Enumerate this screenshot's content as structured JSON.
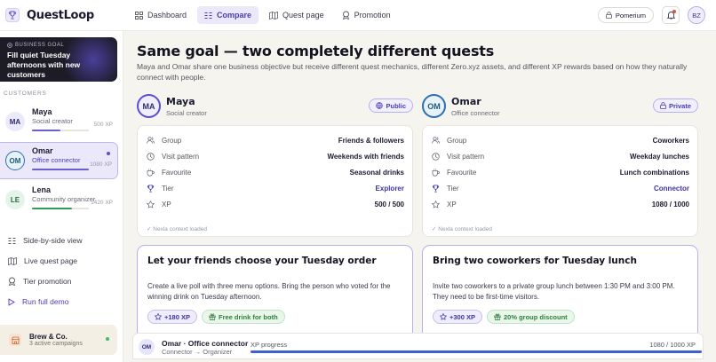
{
  "app": {
    "name": "QuestLoop",
    "logo_icon": "trophy-icon"
  },
  "nav": {
    "items": [
      {
        "label": "Dashboard",
        "icon": "grid-icon"
      },
      {
        "label": "Compare",
        "icon": "columns-icon",
        "active": true
      },
      {
        "label": "Quest page",
        "icon": "map-icon"
      },
      {
        "label": "Promotion",
        "icon": "medal-icon"
      }
    ]
  },
  "header_right": {
    "org": "Pomerium",
    "org_icon": "lock-icon",
    "bell_icon": "bell-icon",
    "user_initials": "BZ"
  },
  "sidebar": {
    "goal": {
      "label": "BUSINESS GOAL",
      "text": "Fill quiet Tuesday afternoons with new customers"
    },
    "customers_label": "CUSTOMERS",
    "customers": [
      {
        "initials": "MA",
        "name": "Maya",
        "role": "Social creator",
        "xp": "500 XP",
        "progress": 0.5
      },
      {
        "initials": "OM",
        "name": "Omar",
        "role": "Office connector",
        "xp": "1080 XP",
        "progress": 1.0,
        "selected": true
      },
      {
        "initials": "LE",
        "name": "Lena",
        "role": "Community organizer",
        "xp": "1420 XP",
        "progress": 0.7
      }
    ],
    "menu": [
      {
        "label": "Side-by-side view",
        "icon": "columns-icon"
      },
      {
        "label": "Live quest page",
        "icon": "map-icon"
      },
      {
        "label": "Tier promotion",
        "icon": "medal-icon"
      },
      {
        "label": "Run full demo",
        "icon": "play-icon"
      }
    ],
    "brand": {
      "name": "Brew & Co.",
      "sub": "3 active campaigns"
    }
  },
  "main": {
    "title": "Same goal — two completely different quests",
    "subtitle": "Maya and Omar share one business objective but receive different quest mechanics, different Zero.xyz assets, and different XP rewards based on how they naturally connect with people.",
    "columns": [
      {
        "initials": "MA",
        "name": "Maya",
        "role": "Social creator",
        "badge": "Public",
        "badge_icon": "globe-icon",
        "rows": [
          {
            "icon": "users-icon",
            "label": "Group",
            "value": "Friends & followers"
          },
          {
            "icon": "clock-icon",
            "label": "Visit pattern",
            "value": "Weekends with friends"
          },
          {
            "icon": "cup-icon",
            "label": "Favourite",
            "value": "Seasonal drinks"
          },
          {
            "icon": "trophy-icon",
            "label": "Tier",
            "value": "Explorer"
          },
          {
            "icon": "star-icon",
            "label": "XP",
            "value": "500 / 500"
          }
        ],
        "context": "Nexla context loaded",
        "quest": {
          "title": "Let your friends choose your Tuesday order",
          "desc": "Create a live poll with three menu options. Bring the person who voted for the winning drink on Tuesday afternoon.",
          "xp": "+180 XP",
          "reward": "Free drink for both"
        }
      },
      {
        "initials": "OM",
        "name": "Omar",
        "role": "Office connector",
        "badge": "Private",
        "badge_icon": "lock-icon",
        "rows": [
          {
            "icon": "users-icon",
            "label": "Group",
            "value": "Coworkers"
          },
          {
            "icon": "clock-icon",
            "label": "Visit pattern",
            "value": "Weekday lunches"
          },
          {
            "icon": "cup-icon",
            "label": "Favourite",
            "value": "Lunch combinations"
          },
          {
            "icon": "trophy-icon",
            "label": "Tier",
            "value": "Connector"
          },
          {
            "icon": "star-icon",
            "label": "XP",
            "value": "1080 / 1000"
          }
        ],
        "context": "Nexla context loaded",
        "quest": {
          "title": "Bring two coworkers for Tuesday lunch",
          "desc": "Invite two coworkers to a private group lunch between 1:30 PM and 3:00 PM. They need to be first-time visitors.",
          "xp": "+300 XP",
          "reward": "20% group discount"
        }
      }
    ]
  },
  "bottom_bar": {
    "initials": "OM",
    "name": "Omar · Office connector",
    "sub": "Connector → Organizer",
    "progress_label": "XP progress",
    "progress_value": "1080 / 1000 XP",
    "progress": 1.0
  }
}
